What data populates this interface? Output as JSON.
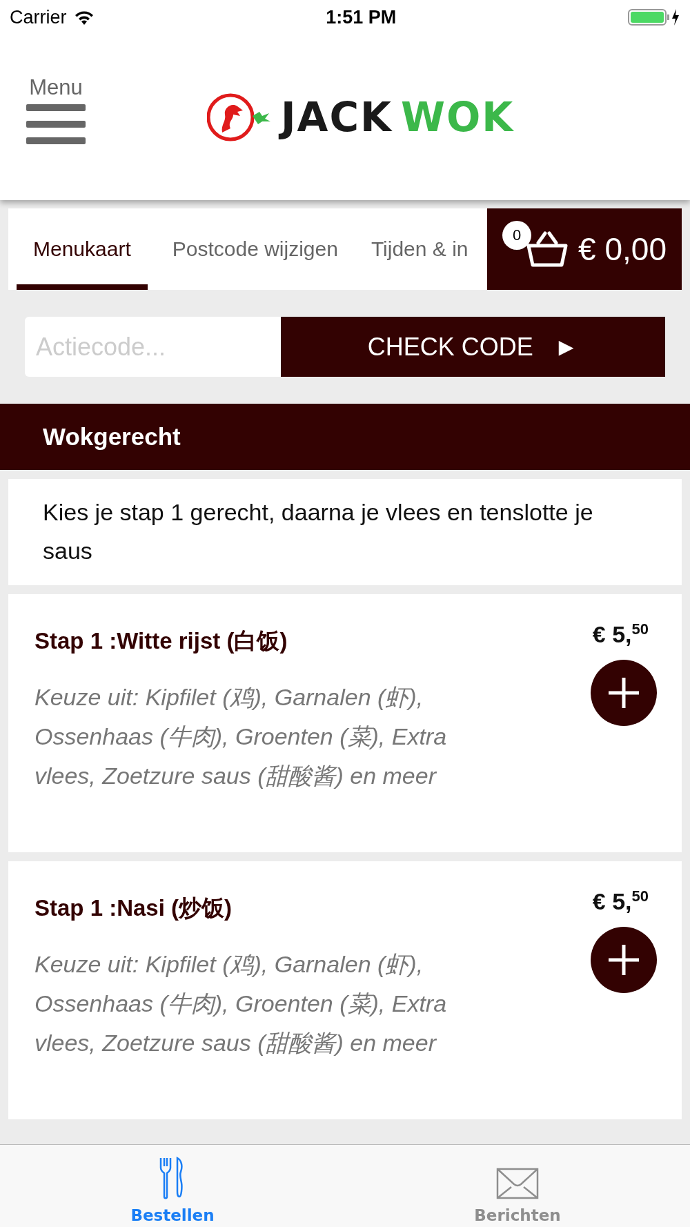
{
  "status_bar": {
    "carrier": "Carrier",
    "time": "1:51 PM"
  },
  "header": {
    "menu_label": "Menu",
    "logo": {
      "word_1": "JACK",
      "word_2": "WOK"
    }
  },
  "tabs": [
    {
      "label": "Menukaart",
      "selected": true
    },
    {
      "label": "Postcode wijzigen",
      "selected": false
    },
    {
      "label": "Tijden & in",
      "selected": false
    }
  ],
  "cart": {
    "count": "0",
    "total": "€ 0,00"
  },
  "promo": {
    "placeholder": "Actiecode...",
    "button": "CHECK CODE",
    "button_icon": "►"
  },
  "section": {
    "title": "Wokgerecht",
    "intro": "Kies je stap 1 gerecht, daarna je vlees en tenslotte je saus"
  },
  "items": [
    {
      "title": "Stap 1 :Witte rijst (白饭)",
      "price": "€ 5,$^{50}$",
      "description": "Keuze uit: Kipfilet (鸡), Garnalen (虾), Ossenhaas (牛肉), Groenten (菜), Extra vlees, Zoetzure saus (甜酸酱) en meer"
    },
    {
      "title": "Stap 1 :Nasi (炒饭)",
      "price": "€ 5,$^{50}$",
      "description": "Keuze uit: Kipfilet (鸡), Garnalen (虾), Ossenhaas (牛肉), Groenten (菜), Extra vlees, Zoetzure saus (甜酸酱) en meer"
    }
  ],
  "tab_bar": [
    {
      "label": "Bestellen",
      "kind": "cutlery",
      "selected": true
    },
    {
      "label": "Berichten",
      "kind": "envelope",
      "selected": false
    }
  ]
}
